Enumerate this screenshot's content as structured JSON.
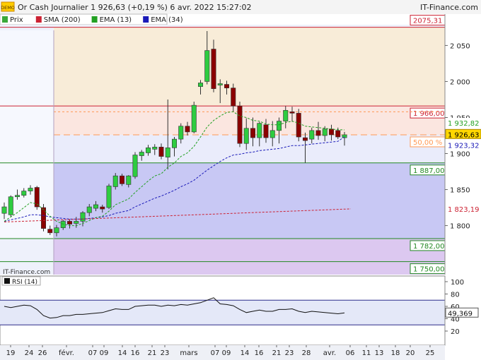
{
  "header": {
    "badge": "DEMO",
    "title": "Or Cash Journalier 1 926,63 (+0,19 %) 6 avr. 2022 15:27:02",
    "brand": "IT-Finance.com"
  },
  "legend": [
    {
      "label": "Prix",
      "color": "#3aa83a",
      "icon": "candle-icon"
    },
    {
      "label": "SMA (200)",
      "color": "#cc2233"
    },
    {
      "label": "EMA (13)",
      "color": "#22a022"
    },
    {
      "label": "EMA (34)",
      "color": "#1a1ab8"
    }
  ],
  "watermark": "IT-Finance.com",
  "rsi_label": "RSI (14)",
  "colors": {
    "up": "#2ecc40",
    "down": "#8b0000",
    "zone_resistance": "#f8ecd8",
    "zone_middle": "#eaecfb",
    "zone_lower": "#c8c8f4",
    "zone_bottom": "#dcc8f0",
    "last_price": "#ffd700"
  },
  "chart_data": [
    {
      "type": "candlestick",
      "x_axis_labels": [
        "19",
        "24",
        "26",
        "févr.",
        "07",
        "09",
        "14",
        "16",
        "21",
        "23",
        "mars",
        "07",
        "09",
        "14",
        "16",
        "21",
        "23",
        "28",
        "avr.",
        "06",
        "11",
        "13",
        "18",
        "20",
        "25"
      ],
      "y_ticks": [
        "2 050",
        "2 000",
        "1 950",
        "1 900",
        "1 850",
        "1 800"
      ],
      "y_range": [
        1750,
        2100
      ],
      "candles": [
        {
          "o": 1817,
          "h": 1832,
          "l": 1809,
          "c": 1826
        },
        {
          "o": 1815,
          "h": 1842,
          "l": 1812,
          "c": 1840
        },
        {
          "o": 1840,
          "h": 1850,
          "l": 1836,
          "c": 1842
        },
        {
          "o": 1842,
          "h": 1852,
          "l": 1839,
          "c": 1848
        },
        {
          "o": 1848,
          "h": 1856,
          "l": 1843,
          "c": 1852
        },
        {
          "o": 1853,
          "h": 1855,
          "l": 1822,
          "c": 1826
        },
        {
          "o": 1825,
          "h": 1830,
          "l": 1792,
          "c": 1796
        },
        {
          "o": 1795,
          "h": 1800,
          "l": 1787,
          "c": 1790
        },
        {
          "o": 1790,
          "h": 1801,
          "l": 1785,
          "c": 1797
        },
        {
          "o": 1797,
          "h": 1808,
          "l": 1794,
          "c": 1806
        },
        {
          "o": 1806,
          "h": 1809,
          "l": 1796,
          "c": 1802
        },
        {
          "o": 1803,
          "h": 1812,
          "l": 1797,
          "c": 1806
        },
        {
          "o": 1806,
          "h": 1820,
          "l": 1799,
          "c": 1818
        },
        {
          "o": 1818,
          "h": 1830,
          "l": 1813,
          "c": 1826
        },
        {
          "o": 1824,
          "h": 1834,
          "l": 1820,
          "c": 1829
        },
        {
          "o": 1826,
          "h": 1829,
          "l": 1818,
          "c": 1823
        },
        {
          "o": 1825,
          "h": 1858,
          "l": 1823,
          "c": 1855
        },
        {
          "o": 1854,
          "h": 1873,
          "l": 1850,
          "c": 1869
        },
        {
          "o": 1869,
          "h": 1872,
          "l": 1855,
          "c": 1858
        },
        {
          "o": 1857,
          "h": 1870,
          "l": 1853,
          "c": 1869
        },
        {
          "o": 1868,
          "h": 1902,
          "l": 1865,
          "c": 1898
        },
        {
          "o": 1897,
          "h": 1905,
          "l": 1890,
          "c": 1902
        },
        {
          "o": 1901,
          "h": 1912,
          "l": 1897,
          "c": 1908
        },
        {
          "o": 1906,
          "h": 1913,
          "l": 1898,
          "c": 1909
        },
        {
          "o": 1909,
          "h": 1914,
          "l": 1892,
          "c": 1896
        },
        {
          "o": 1895,
          "h": 1975,
          "l": 1878,
          "c": 1908
        },
        {
          "o": 1908,
          "h": 1923,
          "l": 1896,
          "c": 1920
        },
        {
          "o": 1920,
          "h": 1942,
          "l": 1914,
          "c": 1938
        },
        {
          "o": 1938,
          "h": 1944,
          "l": 1925,
          "c": 1930
        },
        {
          "o": 1930,
          "h": 1972,
          "l": 1928,
          "c": 1967
        },
        {
          "o": 1993,
          "h": 2002,
          "l": 1982,
          "c": 1998
        },
        {
          "o": 2000,
          "h": 2070,
          "l": 1996,
          "c": 2043
        },
        {
          "o": 2045,
          "h": 2058,
          "l": 1985,
          "c": 1990
        },
        {
          "o": 1995,
          "h": 2003,
          "l": 1970,
          "c": 1997
        },
        {
          "o": 1996,
          "h": 2001,
          "l": 1982,
          "c": 1991
        },
        {
          "o": 1991,
          "h": 1997,
          "l": 1958,
          "c": 1966
        },
        {
          "o": 1966,
          "h": 1972,
          "l": 1909,
          "c": 1914
        },
        {
          "o": 1914,
          "h": 1949,
          "l": 1905,
          "c": 1935
        },
        {
          "o": 1935,
          "h": 1950,
          "l": 1910,
          "c": 1922
        },
        {
          "o": 1922,
          "h": 1944,
          "l": 1910,
          "c": 1942
        },
        {
          "o": 1940,
          "h": 1948,
          "l": 1915,
          "c": 1922
        },
        {
          "o": 1922,
          "h": 1945,
          "l": 1910,
          "c": 1932
        },
        {
          "o": 1932,
          "h": 1950,
          "l": 1914,
          "c": 1945
        },
        {
          "o": 1945,
          "h": 1966,
          "l": 1935,
          "c": 1960
        },
        {
          "o": 1958,
          "h": 1965,
          "l": 1944,
          "c": 1956
        },
        {
          "o": 1956,
          "h": 1962,
          "l": 1917,
          "c": 1923
        },
        {
          "o": 1922,
          "h": 1929,
          "l": 1887,
          "c": 1918
        },
        {
          "o": 1920,
          "h": 1936,
          "l": 1914,
          "c": 1932
        },
        {
          "o": 1932,
          "h": 1944,
          "l": 1919,
          "c": 1925
        },
        {
          "o": 1925,
          "h": 1938,
          "l": 1917,
          "c": 1934
        },
        {
          "o": 1934,
          "h": 1940,
          "l": 1918,
          "c": 1926
        },
        {
          "o": 1932,
          "h": 1936,
          "l": 1920,
          "c": 1923
        },
        {
          "o": 1922,
          "h": 1930,
          "l": 1911,
          "c": 1926
        }
      ],
      "sma200": {
        "from": 1805,
        "to": 1823.19
      },
      "ema13": [
        1806,
        1812,
        1818,
        1825,
        1832,
        1830,
        1822,
        1813,
        1806,
        1802,
        1800,
        1800,
        1803,
        1807,
        1811,
        1813,
        1820,
        1829,
        1833,
        1837,
        1846,
        1854,
        1862,
        1869,
        1872,
        1881,
        1887,
        1896,
        1901,
        1910,
        1923,
        1937,
        1946,
        1952,
        1957,
        1958,
        1952,
        1950,
        1946,
        1945,
        1941,
        1940,
        1940,
        1943,
        1945,
        1942,
        1938,
        1937,
        1936,
        1935,
        1934,
        1933,
        1932.82
      ],
      "ema34": [
        1806,
        1808,
        1810,
        1812,
        1815,
        1815,
        1814,
        1812,
        1811,
        1810,
        1809,
        1809,
        1809,
        1810,
        1811,
        1812,
        1814,
        1817,
        1819,
        1821,
        1826,
        1830,
        1834,
        1838,
        1841,
        1845,
        1849,
        1854,
        1858,
        1863,
        1870,
        1877,
        1883,
        1889,
        1894,
        1898,
        1899,
        1901,
        1902,
        1904,
        1905,
        1906,
        1907,
        1909,
        1911,
        1911,
        1912,
        1913,
        1914,
        1915,
        1916,
        1917,
        1923.32
      ],
      "levels": [
        {
          "value": 2075.31,
          "label": "2075,31",
          "color": "#cc2233"
        },
        {
          "value": 1966.0,
          "label": "1 966,00",
          "color": "#cc2233"
        },
        {
          "value": 1958.0,
          "label": "",
          "color": "#ff9955"
        },
        {
          "value": 1926.0,
          "label": "50,00 %",
          "color": "#ff9955"
        },
        {
          "value": 1887.0,
          "label": "1 887,00",
          "color": "#228822"
        },
        {
          "value": 1782.0,
          "label": "1 782,00",
          "color": "#228822"
        },
        {
          "value": 1750.0,
          "label": "1 750,00",
          "color": "#228822"
        }
      ],
      "value_tags": [
        {
          "value": 1932.82,
          "label": "1 932,82",
          "color": "#22a022"
        },
        {
          "value": 1926.63,
          "label": "1 926,63",
          "color": "#000000"
        },
        {
          "value": 1923.32,
          "label": "1 923,32",
          "color": "#1a1ab8"
        },
        {
          "value": 1823.19,
          "label": "1 823,19",
          "color": "#cc2233"
        }
      ]
    },
    {
      "type": "line",
      "name": "RSI (14)",
      "y_ticks": [
        "100",
        "80",
        "60",
        "40",
        "20"
      ],
      "y_range": [
        0,
        110
      ],
      "levels": [
        70,
        30
      ],
      "last_label": "49,369",
      "values": [
        60,
        58,
        60,
        62,
        61,
        55,
        45,
        41,
        42,
        45,
        45,
        47,
        47,
        48,
        49,
        50,
        53,
        56,
        55,
        55,
        60,
        61,
        62,
        62,
        60,
        62,
        61,
        63,
        62,
        64,
        66,
        70,
        74,
        64,
        63,
        61,
        55,
        50,
        52,
        54,
        52,
        52,
        55,
        55,
        56,
        52,
        50,
        52,
        51,
        50,
        49,
        48,
        49.37
      ]
    }
  ]
}
